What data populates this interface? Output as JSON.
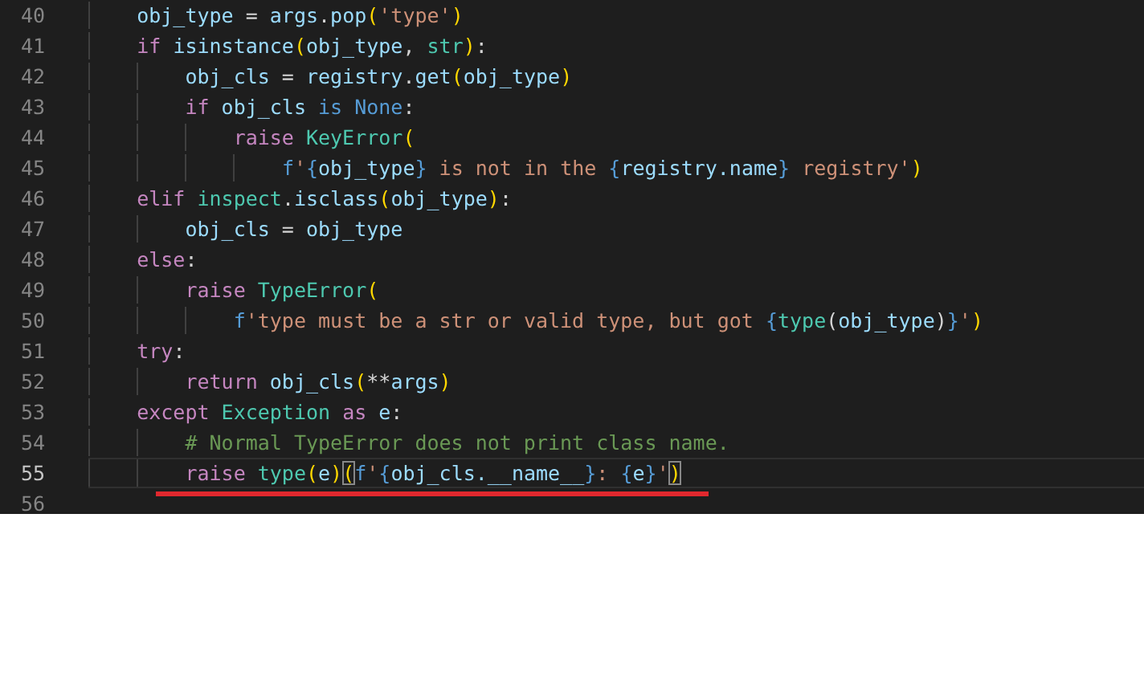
{
  "editor": {
    "lines": [
      {
        "number": "40",
        "current": false,
        "tokens": [
          {
            "text": "    obj_type",
            "kind": "var"
          },
          {
            "text": " = ",
            "kind": "plain"
          },
          {
            "text": "args",
            "kind": "var"
          },
          {
            "text": ".",
            "kind": "plain"
          },
          {
            "text": "pop",
            "kind": "var"
          },
          {
            "text": "(",
            "kind": "bracket",
            "matched": false
          },
          {
            "text": "'type'",
            "kind": "str"
          },
          {
            "text": ")",
            "kind": "bracket",
            "matched": false
          }
        ]
      },
      {
        "number": "41",
        "current": false,
        "tokens": [
          {
            "text": "    if ",
            "kind": "kw"
          },
          {
            "text": "isinstance",
            "kind": "var"
          },
          {
            "text": "(",
            "kind": "bracket",
            "matched": false
          },
          {
            "text": "obj_type",
            "kind": "var"
          },
          {
            "text": ", ",
            "kind": "plain"
          },
          {
            "text": "str",
            "kind": "cls"
          },
          {
            "text": ")",
            "kind": "bracket",
            "matched": false
          },
          {
            "text": ":",
            "kind": "plain"
          }
        ]
      },
      {
        "number": "42",
        "current": false,
        "tokens": [
          {
            "text": "        obj_cls",
            "kind": "var"
          },
          {
            "text": " = ",
            "kind": "plain"
          },
          {
            "text": "registry",
            "kind": "var"
          },
          {
            "text": ".",
            "kind": "plain"
          },
          {
            "text": "get",
            "kind": "var"
          },
          {
            "text": "(",
            "kind": "bracket",
            "matched": false
          },
          {
            "text": "obj_type",
            "kind": "var"
          },
          {
            "text": ")",
            "kind": "bracket",
            "matched": false
          }
        ]
      },
      {
        "number": "43",
        "current": false,
        "tokens": [
          {
            "text": "        if ",
            "kind": "kw"
          },
          {
            "text": "obj_cls ",
            "kind": "var"
          },
          {
            "text": "is None",
            "kind": "const"
          },
          {
            "text": ":",
            "kind": "plain"
          }
        ]
      },
      {
        "number": "44",
        "current": false,
        "tokens": [
          {
            "text": "            raise ",
            "kind": "kw"
          },
          {
            "text": "KeyError",
            "kind": "cls"
          },
          {
            "text": "(",
            "kind": "bracket",
            "matched": false
          }
        ]
      },
      {
        "number": "45",
        "current": false,
        "tokens": [
          {
            "text": "                f",
            "kind": "const"
          },
          {
            "text": "'",
            "kind": "str"
          },
          {
            "text": "{",
            "kind": "const"
          },
          {
            "text": "obj_type",
            "kind": "var"
          },
          {
            "text": "}",
            "kind": "const"
          },
          {
            "text": " is not in the ",
            "kind": "str"
          },
          {
            "text": "{",
            "kind": "const"
          },
          {
            "text": "registry.name",
            "kind": "var"
          },
          {
            "text": "}",
            "kind": "const"
          },
          {
            "text": " registry'",
            "kind": "str"
          },
          {
            "text": ")",
            "kind": "bracket",
            "matched": false
          }
        ]
      },
      {
        "number": "46",
        "current": false,
        "tokens": [
          {
            "text": "    elif ",
            "kind": "kw"
          },
          {
            "text": "inspect",
            "kind": "cls"
          },
          {
            "text": ".",
            "kind": "plain"
          },
          {
            "text": "isclass",
            "kind": "var"
          },
          {
            "text": "(",
            "kind": "bracket",
            "matched": false
          },
          {
            "text": "obj_type",
            "kind": "var"
          },
          {
            "text": ")",
            "kind": "bracket",
            "matched": false
          },
          {
            "text": ":",
            "kind": "plain"
          }
        ]
      },
      {
        "number": "47",
        "current": false,
        "tokens": [
          {
            "text": "        obj_cls",
            "kind": "var"
          },
          {
            "text": " = ",
            "kind": "plain"
          },
          {
            "text": "obj_type",
            "kind": "var"
          }
        ]
      },
      {
        "number": "48",
        "current": false,
        "tokens": [
          {
            "text": "    else",
            "kind": "kw"
          },
          {
            "text": ":",
            "kind": "plain"
          }
        ]
      },
      {
        "number": "49",
        "current": false,
        "tokens": [
          {
            "text": "        raise ",
            "kind": "kw"
          },
          {
            "text": "TypeError",
            "kind": "cls"
          },
          {
            "text": "(",
            "kind": "bracket",
            "matched": false
          }
        ]
      },
      {
        "number": "50",
        "current": false,
        "tokens": [
          {
            "text": "            f",
            "kind": "const"
          },
          {
            "text": "'type must be a str or valid type, but got ",
            "kind": "str"
          },
          {
            "text": "{",
            "kind": "const"
          },
          {
            "text": "type",
            "kind": "cls"
          },
          {
            "text": "(",
            "kind": "plain"
          },
          {
            "text": "obj_type",
            "kind": "var"
          },
          {
            "text": ")",
            "kind": "plain"
          },
          {
            "text": "}",
            "kind": "const"
          },
          {
            "text": "'",
            "kind": "str"
          },
          {
            "text": ")",
            "kind": "bracket",
            "matched": false
          }
        ]
      },
      {
        "number": "51",
        "current": false,
        "tokens": [
          {
            "text": "    try",
            "kind": "kw"
          },
          {
            "text": ":",
            "kind": "plain"
          }
        ]
      },
      {
        "number": "52",
        "current": false,
        "tokens": [
          {
            "text": "        return ",
            "kind": "kw"
          },
          {
            "text": "obj_cls",
            "kind": "var"
          },
          {
            "text": "(",
            "kind": "bracket",
            "matched": false
          },
          {
            "text": "**",
            "kind": "plain"
          },
          {
            "text": "args",
            "kind": "var"
          },
          {
            "text": ")",
            "kind": "bracket",
            "matched": false
          }
        ]
      },
      {
        "number": "53",
        "current": false,
        "tokens": [
          {
            "text": "    except ",
            "kind": "kw"
          },
          {
            "text": "Exception ",
            "kind": "cls"
          },
          {
            "text": "as ",
            "kind": "kw"
          },
          {
            "text": "e",
            "kind": "var"
          },
          {
            "text": ":",
            "kind": "plain"
          }
        ]
      },
      {
        "number": "54",
        "current": false,
        "tokens": [
          {
            "text": "        # Normal TypeError does not print class name.",
            "kind": "comment"
          }
        ]
      },
      {
        "number": "55",
        "current": true,
        "underlined": true,
        "tokens": [
          {
            "text": "        raise ",
            "kind": "kw"
          },
          {
            "text": "type",
            "kind": "cls"
          },
          {
            "text": "(",
            "kind": "bracket",
            "matched": false
          },
          {
            "text": "e",
            "kind": "var"
          },
          {
            "text": ")",
            "kind": "bracket",
            "matched": false
          },
          {
            "text": "(",
            "kind": "bracket",
            "matched": true
          },
          {
            "text": "f",
            "kind": "const"
          },
          {
            "text": "'",
            "kind": "str"
          },
          {
            "text": "{",
            "kind": "const"
          },
          {
            "text": "obj_cls.__name__",
            "kind": "var"
          },
          {
            "text": "}",
            "kind": "const"
          },
          {
            "text": ": ",
            "kind": "str"
          },
          {
            "text": "{",
            "kind": "const"
          },
          {
            "text": "e",
            "kind": "var"
          },
          {
            "text": "}",
            "kind": "const"
          },
          {
            "text": "'",
            "kind": "str"
          },
          {
            "text": ")",
            "kind": "bracket",
            "matched": true
          }
        ]
      },
      {
        "number": "56",
        "current": false
      }
    ]
  }
}
